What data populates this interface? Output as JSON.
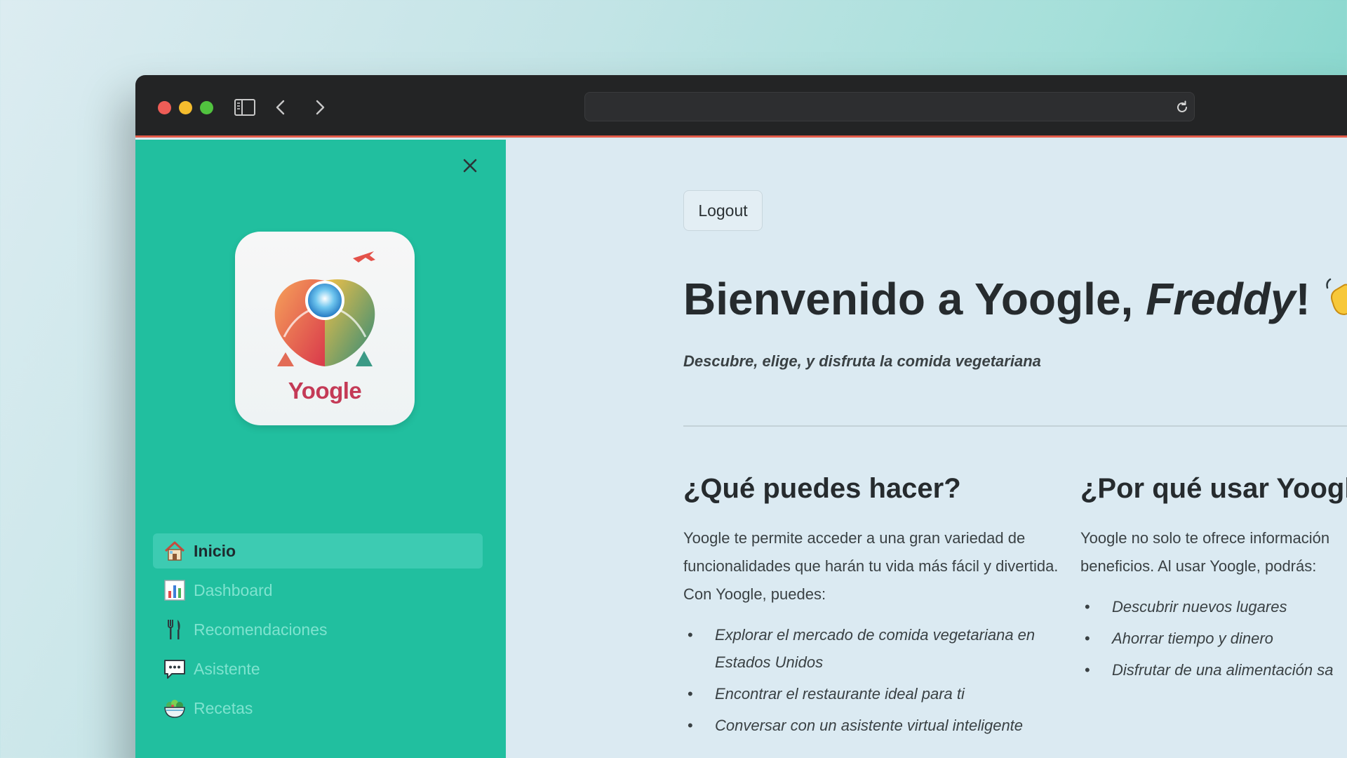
{
  "browser": {
    "url": ""
  },
  "sidebar": {
    "logo_text": "Yoogle",
    "items": [
      {
        "label": "Inicio",
        "icon": "house-icon",
        "active": true
      },
      {
        "label": "Dashboard",
        "icon": "bar-chart-icon",
        "active": false
      },
      {
        "label": "Recomendaciones",
        "icon": "fork-knife-icon",
        "active": false
      },
      {
        "label": "Asistente",
        "icon": "speech-bubble-icon",
        "active": false
      },
      {
        "label": "Recetas",
        "icon": "salad-bowl-icon",
        "active": false
      }
    ]
  },
  "main": {
    "logout_label": "Logout",
    "hero_prefix": "Bienvenido a Yoogle, ",
    "hero_name": "Freddy",
    "hero_suffix": "!",
    "subtitle": "Descubre, elige, y disfruta la comida vegetariana",
    "left_col": {
      "heading": "¿Qué puedes hacer?",
      "paragraph": "Yoogle te permite acceder a una gran variedad de funcionalidades que harán tu vida más fácil y divertida. Con Yoogle, puedes:",
      "bullets": [
        "Explorar el mercado de comida vegetariana en Estados Unidos",
        "Encontrar el restaurante ideal para ti",
        "Conversar con un asistente virtual inteligente"
      ]
    },
    "right_col": {
      "heading": "¿Por qué usar Yoogle",
      "paragraph_line1": "Yoogle no solo te ofrece información",
      "paragraph_line2": "beneficios. Al usar Yoogle, podrás:",
      "bullets": [
        "Descubrir nuevos lugares",
        "Ahorrar tiempo y dinero",
        "Disfrutar de una alimentación sa"
      ]
    }
  },
  "colors": {
    "sidebar_bg": "#21bf9f",
    "sidebar_active": "#3dcbb2",
    "main_bg": "#dbeaf2",
    "titlebar": "#232425",
    "accent_line": "#e45c4a"
  }
}
